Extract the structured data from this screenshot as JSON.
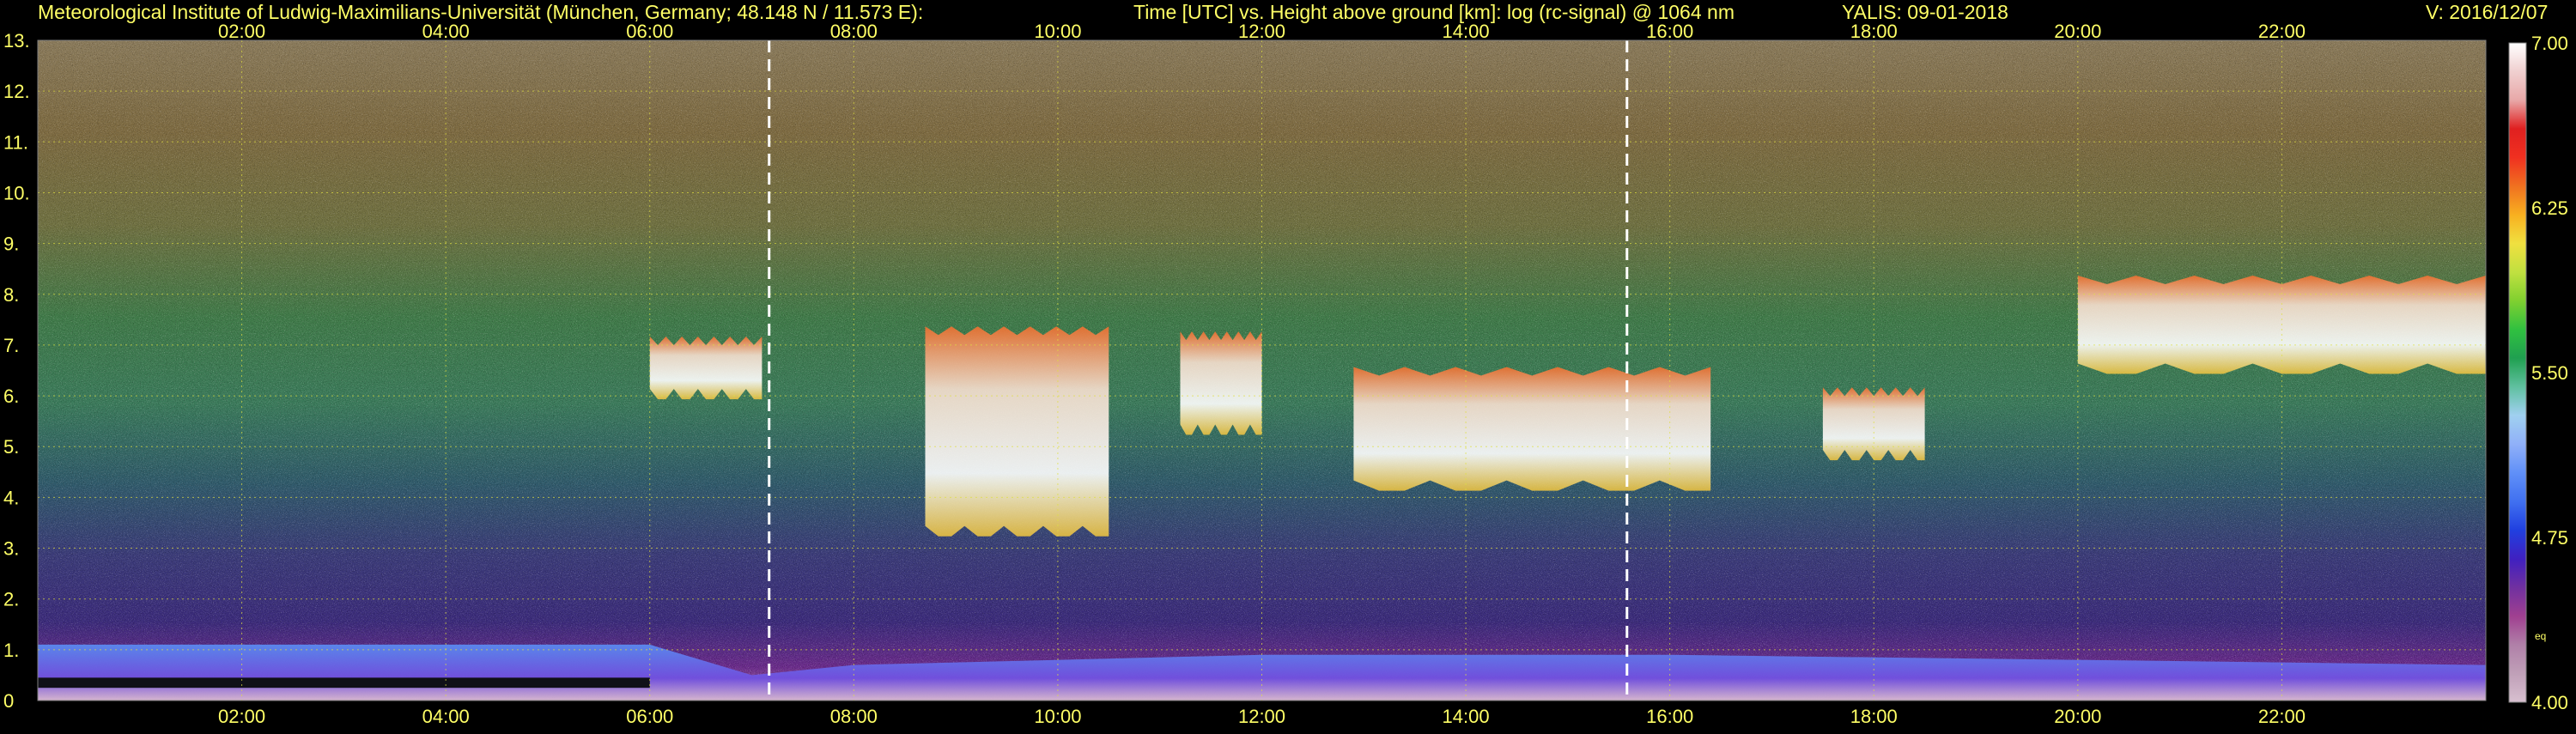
{
  "header": {
    "institute": "Meteorological Institute of Ludwig-Maximilians-Universität (München, Germany; 48.148 N / 11.573 E):",
    "plot_title": "Time [UTC] vs. Height above ground [km]: log (rc-signal) @ 1064 nm",
    "station_date": "YALIS: 09-01-2018",
    "version": "V: 2016/12/07"
  },
  "chart_data": {
    "type": "heatmap",
    "title": "Time [UTC] vs. Height above ground [km]: log (rc-signal) @ 1064 nm",
    "x_tick_labels": [
      "02:00",
      "04:00",
      "06:00",
      "08:00",
      "10:00",
      "12:00",
      "14:00",
      "16:00",
      "18:00",
      "20:00",
      "22:00"
    ],
    "x_ticks_hours": [
      2,
      4,
      6,
      8,
      10,
      12,
      14,
      16,
      18,
      20,
      22
    ],
    "xlim_hours": [
      0,
      24
    ],
    "y_tick_labels": [
      "0",
      "1.",
      "2.",
      "3.",
      "4.",
      "5.",
      "6.",
      "7.",
      "8.",
      "9.",
      "10.",
      "11.",
      "12.",
      "13."
    ],
    "y_ticks_km": [
      0,
      1,
      2,
      3,
      4,
      5,
      6,
      7,
      8,
      9,
      10,
      11,
      12,
      13
    ],
    "ylim_km": [
      0,
      13
    ],
    "grid": true,
    "colorbar": {
      "min": 4.0,
      "max": 7.0,
      "tick_labels": [
        "4.00",
        "4.75",
        "5.50",
        "6.25",
        "7.00"
      ],
      "ticks": [
        4.0,
        4.75,
        5.5,
        6.25,
        7.0
      ],
      "note": "eq",
      "colors": [
        "#d8c0d0",
        "#c0a0b8",
        "#b080a8",
        "#a04090",
        "#7030a0",
        "#4020c0",
        "#2040e0",
        "#4070f0",
        "#6090f8",
        "#90b0f8",
        "#a0d0f0",
        "#60c0a0",
        "#20a050",
        "#30c040",
        "#80d030",
        "#c0e040",
        "#f0e040",
        "#f8b020",
        "#f07020",
        "#f03020",
        "#e02020",
        "#e8a8a8",
        "#f0d0d0",
        "#ffffff"
      ]
    },
    "dashed_markers_hours": [
      7.17,
      15.58
    ],
    "cloud_layers": [
      {
        "t_start": 6.0,
        "t_end": 7.1,
        "h_top": 7.1,
        "h_base": 6.0
      },
      {
        "t_start": 8.7,
        "t_end": 10.5,
        "h_top": 7.3,
        "h_base": 3.3
      },
      {
        "t_start": 11.2,
        "t_end": 12.0,
        "h_top": 7.2,
        "h_base": 5.3
      },
      {
        "t_start": 12.9,
        "t_end": 16.4,
        "h_top": 6.5,
        "h_base": 4.2
      },
      {
        "t_start": 17.5,
        "t_end": 18.5,
        "h_top": 6.1,
        "h_base": 4.8
      },
      {
        "t_start": 20.0,
        "t_end": 24.0,
        "h_top": 8.3,
        "h_base": 6.5
      }
    ],
    "boundary_layer_top_km": [
      {
        "t": 0.0,
        "h": 1.1
      },
      {
        "t": 6.0,
        "h": 1.1
      },
      {
        "t": 7.0,
        "h": 0.5
      },
      {
        "t": 8.0,
        "h": 0.7
      },
      {
        "t": 12.0,
        "h": 0.9
      },
      {
        "t": 16.0,
        "h": 0.9
      },
      {
        "t": 20.0,
        "h": 0.8
      },
      {
        "t": 24.0,
        "h": 0.7
      }
    ]
  }
}
